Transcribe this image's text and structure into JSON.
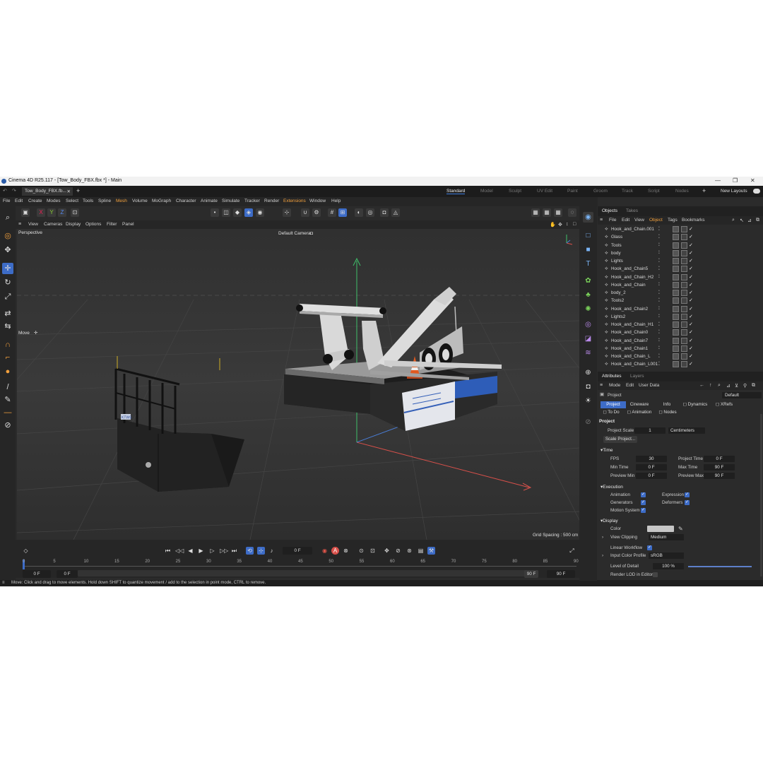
{
  "window": {
    "title": "Cinema 4D R25.117 - [Tow_Body_FBX.fbx *] - Main"
  },
  "file_tab": {
    "label": "Tow_Body_FBX.fb..."
  },
  "layouts": {
    "items": [
      "Standard",
      "Model",
      "Sculpt",
      "UV Edit",
      "Paint",
      "Groom",
      "Track",
      "Script",
      "Nodes"
    ],
    "new_label": "New Layouts"
  },
  "menu": {
    "items": [
      "File",
      "Edit",
      "Create",
      "Modes",
      "Select",
      "Tools",
      "Spline",
      "Mesh",
      "Volume",
      "MoGraph",
      "Character",
      "Animate",
      "Simulate",
      "Tracker",
      "Render",
      "Extensions",
      "Window",
      "Help"
    ]
  },
  "viewport_menu": {
    "items": [
      "View",
      "Cameras",
      "Display",
      "Options",
      "Filter",
      "Panel"
    ]
  },
  "viewport": {
    "projection": "Perspective",
    "camera": "Default Camera",
    "camera_icon": "camera-icon",
    "tool_label": "Move",
    "grid_spacing": "Grid Spacing : 500 cm",
    "plate_text": "KTWS"
  },
  "timeline": {
    "current_frame": "0 F",
    "ticks": [
      "0",
      "5",
      "10",
      "15",
      "20",
      "25",
      "30",
      "35",
      "40",
      "45",
      "50",
      "55",
      "60",
      "65",
      "70",
      "75",
      "80",
      "85",
      "90"
    ],
    "range_start": "0 F",
    "range_start2": "0 F",
    "range_end": "90 F",
    "range_end2": "90 F"
  },
  "status": {
    "text": "Move: Click and drag to move elements. Hold down SHIFT to quantize movement / add to the selection in point mode, CTRL to remove."
  },
  "objects_panel": {
    "tabs": [
      "Objects",
      "Takes"
    ],
    "menu": [
      "File",
      "Edit",
      "View",
      "Object",
      "Tags",
      "Bookmarks"
    ],
    "items": [
      {
        "name": "Hook_and_Chain.001"
      },
      {
        "name": "Glass"
      },
      {
        "name": "Tools"
      },
      {
        "name": "body"
      },
      {
        "name": "Lights"
      },
      {
        "name": "Hook_and_Chain5"
      },
      {
        "name": "Hook_and_Chain_H2"
      },
      {
        "name": "Hook_and_Chain"
      },
      {
        "name": "body_2"
      },
      {
        "name": "Tools2"
      },
      {
        "name": "Hook_and_Chain2"
      },
      {
        "name": "Lights2"
      },
      {
        "name": "Hook_and_Chain_H1"
      },
      {
        "name": "Hook_and_Chain0"
      },
      {
        "name": "Hook_and_Chain7"
      },
      {
        "name": "Hook_and_Chain1"
      },
      {
        "name": "Hook_and_Chain_L"
      },
      {
        "name": "Hook_and_Chain_L001"
      }
    ]
  },
  "attributes_panel": {
    "tabs": [
      "Attributes",
      "Layers"
    ],
    "menu": [
      "Mode",
      "Edit",
      "User Data"
    ],
    "object_label": "Project",
    "preset": "Default",
    "subtabs_row1": [
      "Project",
      "Cineware",
      "Info",
      "Dynamics",
      "XRefs"
    ],
    "subtabs_row2": [
      "To Do",
      "Animation",
      "Nodes"
    ],
    "project_header": "Project",
    "project_scale_label": "Project Scale",
    "project_scale_value": "1",
    "project_scale_unit": "Centimeters",
    "scale_button": "Scale Project...",
    "time_header": "Time",
    "fps_label": "FPS",
    "fps_value": "30",
    "project_time_label": "Project Time",
    "project_time_value": "0 F",
    "min_time_label": "Min Time",
    "min_time_value": "0 F",
    "max_time_label": "Max Time",
    "max_time_value": "90 F",
    "preview_min_label": "Preview Min",
    "preview_min_value": "0 F",
    "preview_max_label": "Preview Max",
    "preview_max_value": "90 F",
    "execution_header": "Execution",
    "animation_label": "Animation",
    "expression_label": "Expression",
    "generators_label": "Generators",
    "deformers_label": "Deformers",
    "motion_system_label": "Motion System",
    "display_header": "Display",
    "color_label": "Color",
    "view_clipping_label": "View Clipping",
    "view_clipping_value": "Medium",
    "linear_workflow_label": "Linear Workflow",
    "input_color_profile_label": "Input Color Profile",
    "input_color_profile_value": "sRGB",
    "lod_label": "Level of Detail",
    "lod_value": "100 %",
    "render_lod_label": "Render LOD in Editor"
  },
  "colors": {
    "accent": "#3d6cc7",
    "highlight_menu": "#f2a03d",
    "axis_y": "#3fbf6a",
    "axis_x": "#d8504a",
    "axis_z": "#4a7ed8"
  }
}
